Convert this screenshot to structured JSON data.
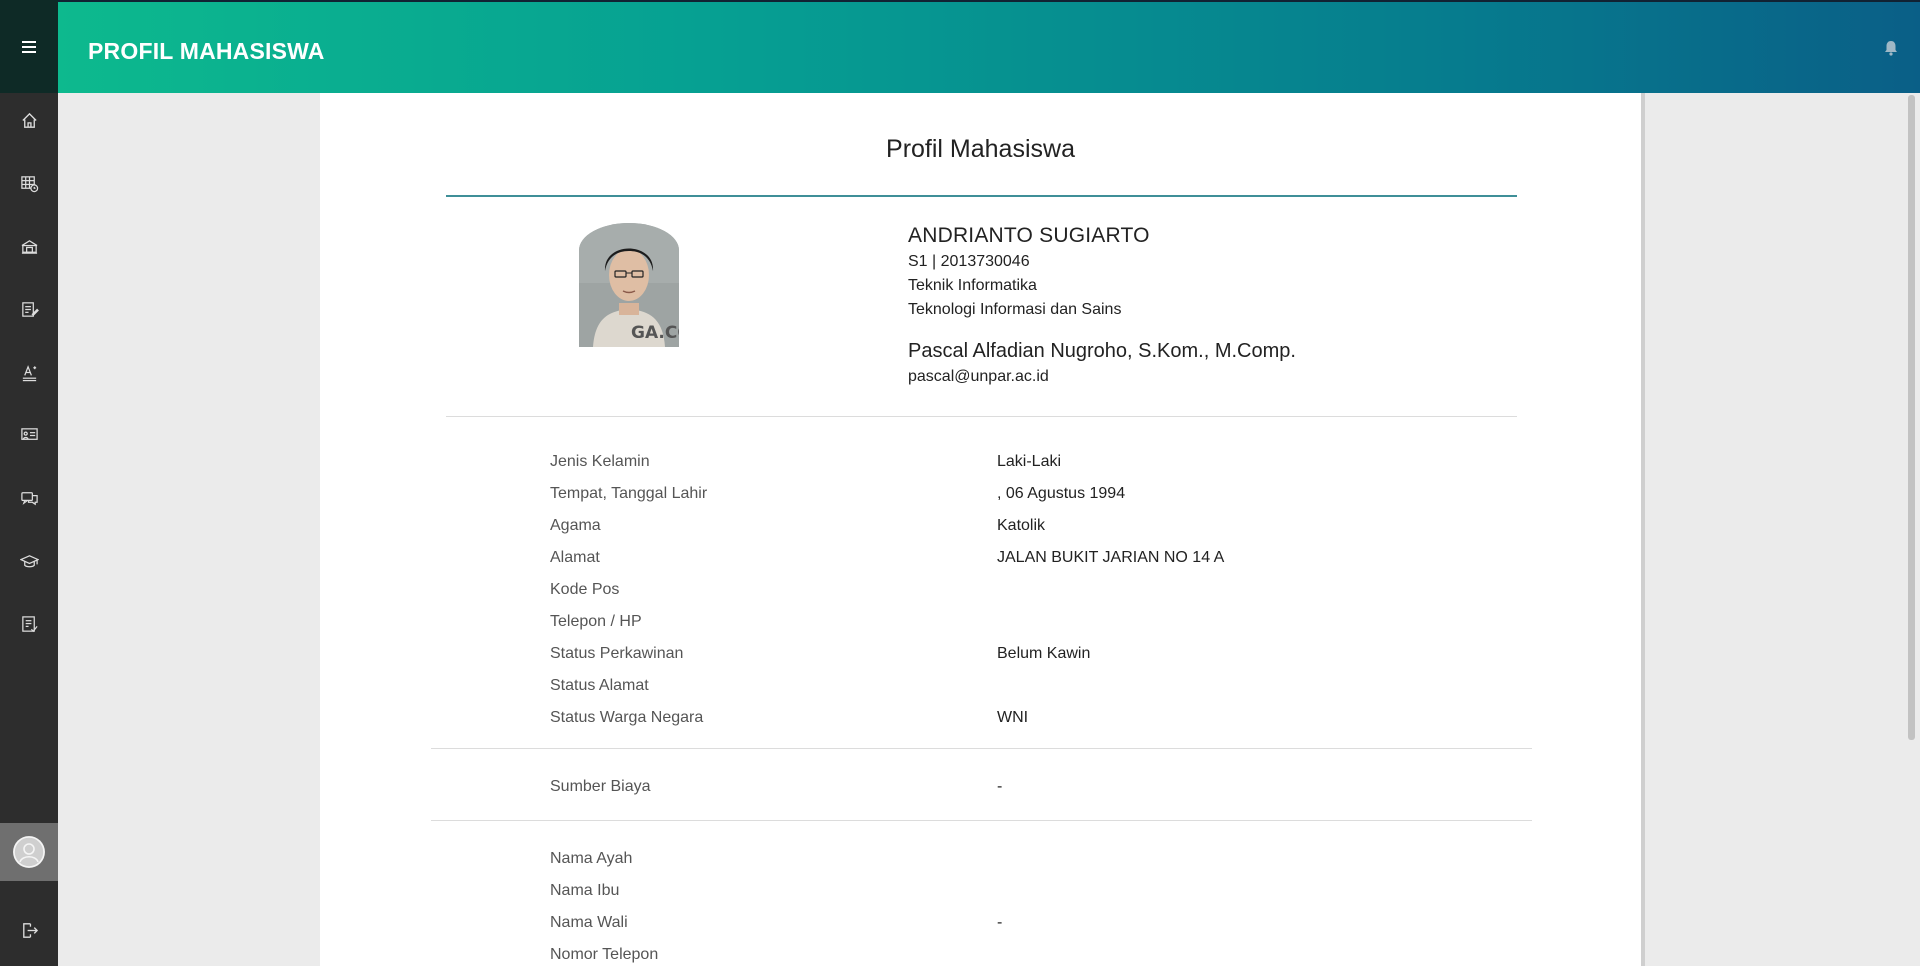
{
  "header": {
    "title": "PROFIL MAHASISWA"
  },
  "sidebar": {
    "items": [
      {
        "icon": "home-icon"
      },
      {
        "icon": "schedule-icon"
      },
      {
        "icon": "building-icon"
      },
      {
        "icon": "document-edit-icon"
      },
      {
        "icon": "text-format-icon"
      },
      {
        "icon": "presentation-icon"
      },
      {
        "icon": "chat-icon"
      },
      {
        "icon": "graduation-cap-icon"
      },
      {
        "icon": "checklist-icon"
      }
    ]
  },
  "page": {
    "title": "Profil Mahasiswa"
  },
  "student": {
    "name": "ANDRIANTO SUGIARTO",
    "program_npm": "S1 | 2013730046",
    "major": "Teknik Informatika",
    "faculty": "Teknologi Informasi dan Sains"
  },
  "advisor": {
    "name": "Pascal Alfadian Nugroho, S.Kom., M.Comp.",
    "email": "pascal@unpar.ac.id"
  },
  "personal": [
    {
      "label": "Jenis Kelamin",
      "value": "Laki-Laki"
    },
    {
      "label": "Tempat, Tanggal Lahir",
      "value": ", 06 Agustus 1994"
    },
    {
      "label": "Agama",
      "value": "Katolik"
    },
    {
      "label": "Alamat",
      "value": "JALAN BUKIT JARIAN NO 14 A"
    },
    {
      "label": "Kode Pos",
      "value": ""
    },
    {
      "label": "Telepon / HP",
      "value": ""
    },
    {
      "label": "Status Perkawinan",
      "value": "Belum Kawin"
    },
    {
      "label": "Status Alamat",
      "value": ""
    },
    {
      "label": "Status Warga Negara",
      "value": "WNI"
    }
  ],
  "funding": [
    {
      "label": "Sumber Biaya",
      "value": "-"
    }
  ],
  "family": [
    {
      "label": "Nama Ayah",
      "value": ""
    },
    {
      "label": "Nama Ibu",
      "value": ""
    },
    {
      "label": "Nama Wali",
      "value": "-"
    },
    {
      "label": "Nomor Telepon",
      "value": ""
    }
  ],
  "colors": {
    "header_start": "#0db98e",
    "header_end": "#0a5f87",
    "sidebar": "#2d2d2d",
    "accent_rule": "#3f8f98"
  }
}
